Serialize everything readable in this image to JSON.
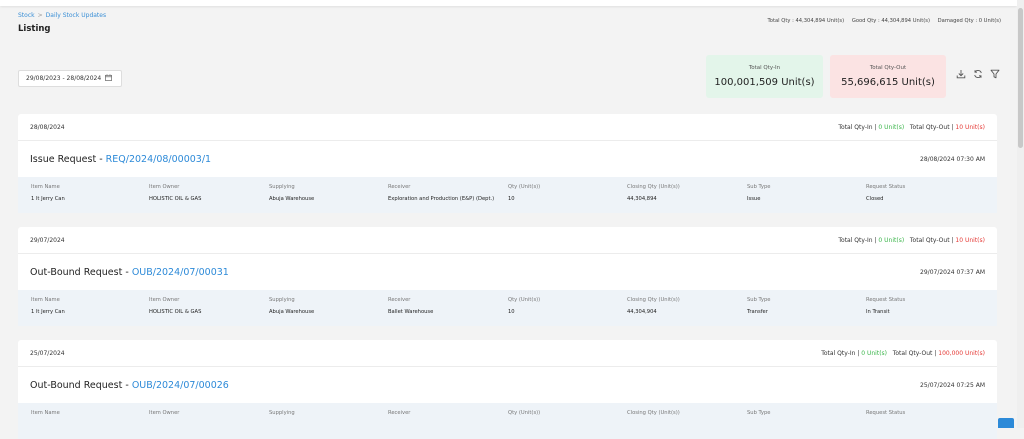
{
  "breadcrumb": {
    "root": "Stock",
    "current": "Daily Stock Updates"
  },
  "page_title": "Listing",
  "totals_summary": {
    "total": "Total Qty : 44,304,894 Unit(s)",
    "good": "Good Qty : 44,304,894 Unit(s)",
    "damaged": "Damaged Qty : 0 Unit(s)"
  },
  "date_range": {
    "value": "29/08/2023 - 28/08/2024"
  },
  "cards": {
    "in": {
      "label": "Total Qty-In",
      "value": "100,001,509 Unit(s)"
    },
    "out": {
      "label": "Total Qty-Out",
      "value": "55,696,615 Unit(s)"
    }
  },
  "icons": [
    "download-icon",
    "refresh-icon",
    "filter-icon"
  ],
  "colors": {
    "accent": "#2d8ad8",
    "green": "#3ab54a",
    "red": "#e53935",
    "in_card": "#e3f5ea",
    "out_card": "#fbe3e3"
  },
  "columns": [
    "Item Name",
    "Item Owner",
    "Supplying",
    "Receiver",
    "Qty (Unit(s))",
    "Closing Qty (Unit(s))",
    "Sub Type",
    "Request Status"
  ],
  "groups": [
    {
      "date": "28/08/2024",
      "qty_in_label": "Total Qty-In |",
      "qty_in": "0 Unit(s)",
      "qty_out_label": "Total Qty-Out |",
      "qty_out": "10 Unit(s)",
      "request_type": "Issue Request -",
      "request_code": "REQ/2024/08/00003/1",
      "request_datetime": "28/08/2024 07:30 AM",
      "row": {
        "item_name": "1 lt Jerry Can",
        "item_owner": "HOLISTIC OIL & GAS",
        "supplying": "Abuja Warehouse",
        "receiver": "Exploration and Production (E&P) (Dept.)",
        "qty": "10",
        "closing_qty": "44,304,894",
        "sub_type": "Issue",
        "status": "Closed"
      }
    },
    {
      "date": "29/07/2024",
      "qty_in_label": "Total Qty-In |",
      "qty_in": "0 Unit(s)",
      "qty_out_label": "Total Qty-Out |",
      "qty_out": "10 Unit(s)",
      "request_type": "Out-Bound Request -",
      "request_code": "OUB/2024/07/00031",
      "request_datetime": "29/07/2024 07:37 AM",
      "row": {
        "item_name": "1 lt Jerry Can",
        "item_owner": "HOLISTIC OIL & GAS",
        "supplying": "Abuja Warehouse",
        "receiver": "Ballet Warehouse",
        "qty": "10",
        "closing_qty": "44,304,904",
        "sub_type": "Transfer",
        "status": "In Transit"
      }
    },
    {
      "date": "25/07/2024",
      "qty_in_label": "Total Qty-In |",
      "qty_in": "0 Unit(s)",
      "qty_out_label": "Total Qty-Out |",
      "qty_out": "100,000 Unit(s)",
      "request_type": "Out-Bound Request -",
      "request_code": "OUB/2024/07/00026",
      "request_datetime": "25/07/2024 07:25 AM"
    }
  ]
}
